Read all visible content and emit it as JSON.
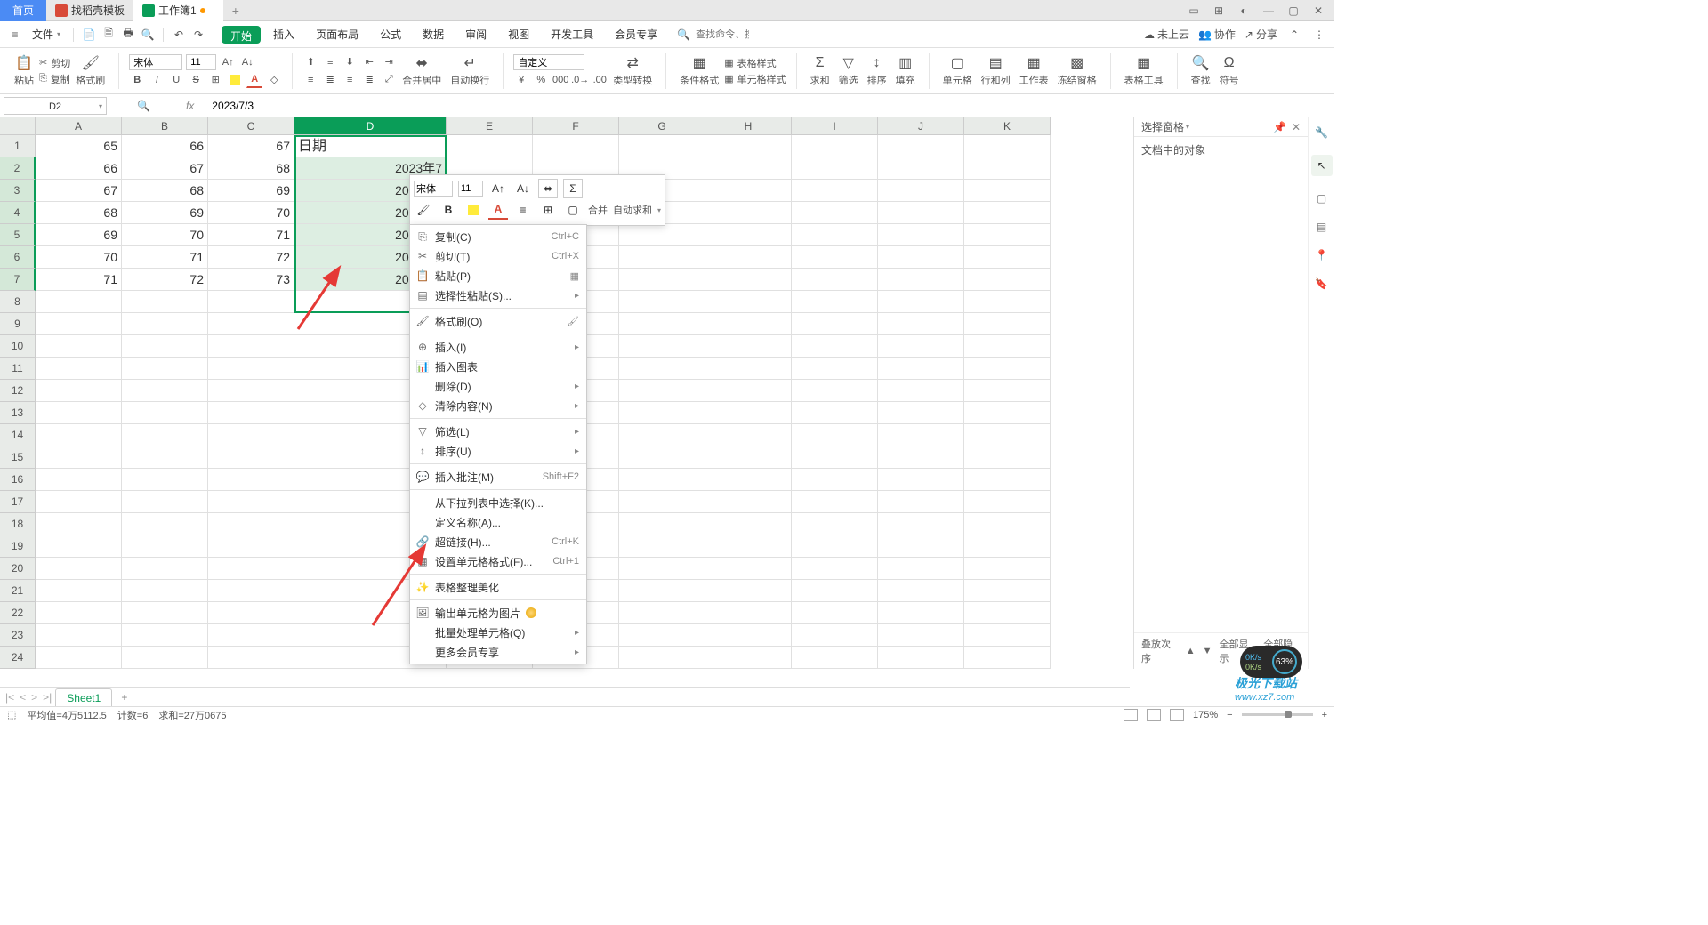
{
  "titlebar": {
    "home": "首页",
    "tabs": [
      {
        "label": "找稻壳模板"
      },
      {
        "label": "工作簿1"
      }
    ]
  },
  "menubar": {
    "file": "文件",
    "tabs": [
      "开始",
      "插入",
      "页面布局",
      "公式",
      "数据",
      "审阅",
      "视图",
      "开发工具",
      "会员专享"
    ],
    "search_ph": "查找命令、搜索模板",
    "cloud": "未上云",
    "coop": "协作",
    "share": "分享"
  },
  "ribbon": {
    "paste": "粘贴",
    "cut": "剪切",
    "copy": "复制",
    "fmtpaint": "格式刷",
    "font_name": "宋体",
    "font_size": "11",
    "merge": "合并居中",
    "wrap": "自动换行",
    "numfmt": "自定义",
    "typeconv": "类型转换",
    "condfmt": "条件格式",
    "tablestyle": "表格样式",
    "cellstyle": "单元格样式",
    "sum": "求和",
    "filter": "筛选",
    "sort": "排序",
    "fill": "填充",
    "cell": "单元格",
    "rowcol": "行和列",
    "sheet": "工作表",
    "freeze": "冻结窗格",
    "tabletool": "表格工具",
    "find": "查找",
    "symbol": "符号"
  },
  "fbar": {
    "name": "D2",
    "formula": "2023/7/3"
  },
  "columns": [
    "A",
    "B",
    "C",
    "D",
    "E",
    "F",
    "G",
    "H",
    "I",
    "J",
    "K"
  ],
  "data": {
    "d_header": "日期",
    "rows": [
      {
        "a": "65",
        "b": "66",
        "c": "67",
        "d": "日期"
      },
      {
        "a": "66",
        "b": "67",
        "c": "68",
        "d": "2023年7"
      },
      {
        "a": "67",
        "b": "68",
        "c": "69",
        "d": "2023年7"
      },
      {
        "a": "68",
        "b": "69",
        "c": "70",
        "d": "2023年7"
      },
      {
        "a": "69",
        "b": "70",
        "c": "71",
        "d": "2023年7"
      },
      {
        "a": "70",
        "b": "71",
        "c": "72",
        "d": "2023年7"
      },
      {
        "a": "71",
        "b": "72",
        "c": "73",
        "d": "2023年7"
      }
    ]
  },
  "mini": {
    "font": "宋体",
    "size": "11",
    "merge": "合并",
    "autosum": "自动求和"
  },
  "ctx": {
    "copy": {
      "t": "复制(C)",
      "sc": "Ctrl+C"
    },
    "cut": {
      "t": "剪切(T)",
      "sc": "Ctrl+X"
    },
    "paste": {
      "t": "粘贴(P)"
    },
    "paste_sp": {
      "t": "选择性粘贴(S)..."
    },
    "fmt_paint": {
      "t": "格式刷(O)"
    },
    "insert": {
      "t": "插入(I)"
    },
    "ins_chart": {
      "t": "插入图表"
    },
    "delete": {
      "t": "删除(D)"
    },
    "clear": {
      "t": "清除内容(N)"
    },
    "filter": {
      "t": "筛选(L)"
    },
    "sort": {
      "t": "排序(U)"
    },
    "comment": {
      "t": "插入批注(M)",
      "sc": "Shift+F2"
    },
    "dropdown": {
      "t": "从下拉列表中选择(K)..."
    },
    "defname": {
      "t": "定义名称(A)..."
    },
    "link": {
      "t": "超链接(H)...",
      "sc": "Ctrl+K"
    },
    "cellfmt": {
      "t": "设置单元格格式(F)...",
      "sc": "Ctrl+1"
    },
    "beautify": {
      "t": "表格整理美化"
    },
    "export_img": {
      "t": "输出单元格为图片"
    },
    "batch": {
      "t": "批量处理单元格(Q)"
    },
    "member": {
      "t": "更多会员专享"
    }
  },
  "rpanel": {
    "title": "选择窗格",
    "obj": "文档中的对象",
    "stack": "叠放次序",
    "show_all": "全部显示",
    "hide_all": "全部隐藏"
  },
  "sheet": {
    "name": "Sheet1"
  },
  "status": {
    "avg_lbl": "平均值=",
    "avg": "4万5112.5",
    "cnt_lbl": "计数=",
    "cnt": "6",
    "sum_lbl": "求和=",
    "sum": "27万0675",
    "zoom": "175%"
  },
  "widget": {
    "up": "0K/s",
    "down": "0K/s",
    "pct": "63%"
  },
  "watermark": {
    "top": "极光下载站",
    "bot": "www.xz7.com"
  }
}
